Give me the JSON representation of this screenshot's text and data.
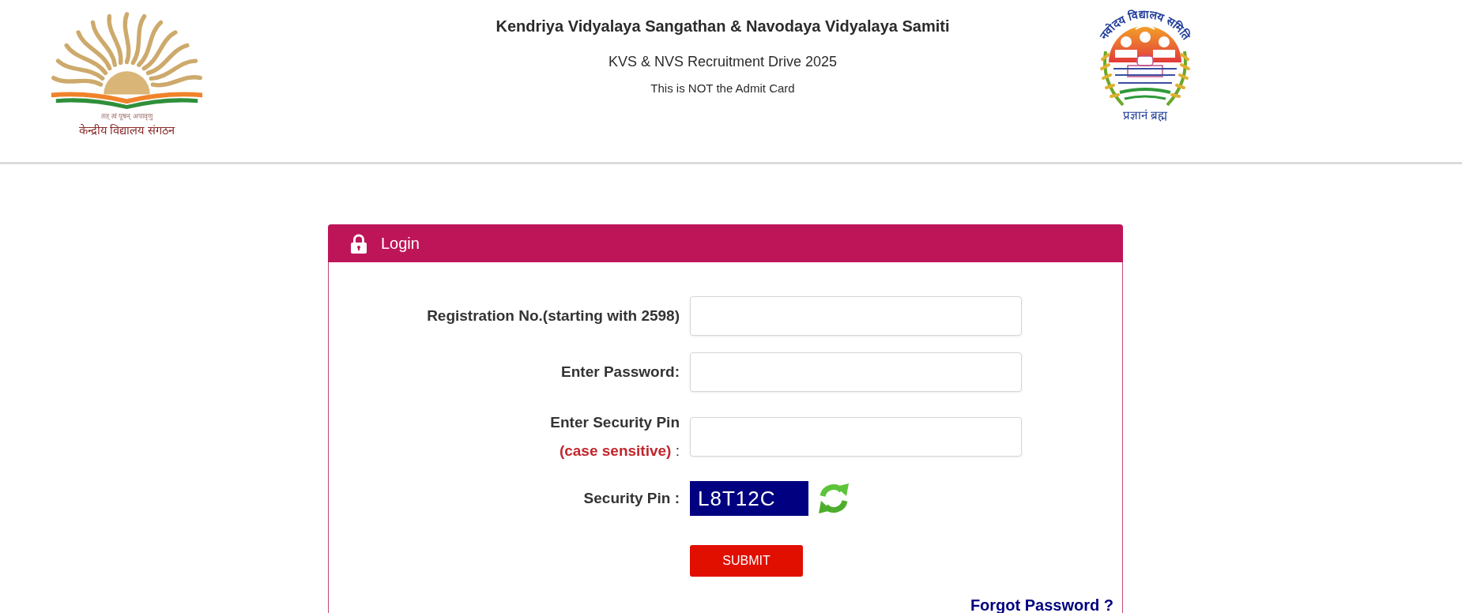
{
  "header": {
    "left_logo": {
      "motto": "तत् त्वं पूषन् अपावृणु",
      "caption": "केन्द्रीय विद्यालय संगठन"
    },
    "title": "Kendriya Vidyalaya Sangathan & Navodaya Vidyalaya Samiti",
    "subtitle": "KVS & NVS Recruitment Drive 2025",
    "note": "This is NOT the Admit Card",
    "right_logo": {
      "arc_text": "नवोदय विद्यालय समिति",
      "motto": "प्रज्ञानं ब्रह्म"
    }
  },
  "login_panel": {
    "title": "Login",
    "fields": [
      {
        "kind": "input",
        "label": "Registration No.(starting with 2598)"
      },
      {
        "kind": "input",
        "label": "Enter Password:"
      },
      {
        "kind": "input",
        "label": "Enter Security Pin",
        "hint": "(case sensitive)",
        "suffix": ":"
      },
      {
        "kind": "captcha",
        "label": "Security Pin :",
        "code": "L8T12C"
      }
    ],
    "submit": "SUBMIT",
    "forgot_link": "Forgot Password ?"
  }
}
